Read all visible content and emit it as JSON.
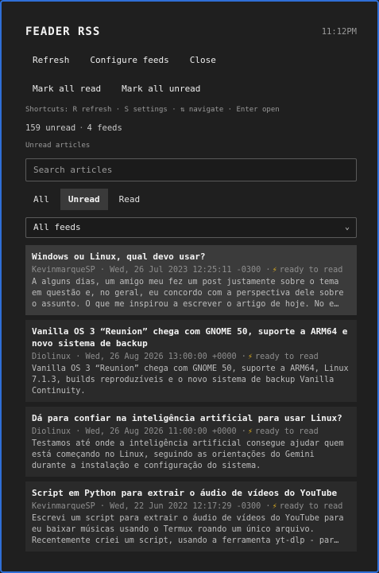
{
  "app": {
    "title": "FEADER RSS",
    "clock": "11:12PM"
  },
  "toolbar": {
    "refresh": "Refresh",
    "configure": "Configure feeds",
    "close": "Close",
    "mark_all_read": "Mark all read",
    "mark_all_unread": "Mark all unread"
  },
  "shortcuts": "Shortcuts: R refresh · S settings · ⇅ navigate · Enter open",
  "counts": {
    "unread": "159 unread",
    "sep": "·",
    "feeds": "4 feeds"
  },
  "section_label": "Unread articles",
  "search": {
    "placeholder": "Search articles",
    "value": ""
  },
  "tabs": [
    {
      "label": "All",
      "active": false
    },
    {
      "label": "Unread",
      "active": true
    },
    {
      "label": "Read",
      "active": false
    }
  ],
  "feed_filter": {
    "selected": "All feeds"
  },
  "articles": [
    {
      "title": "Windows ou Linux, qual devo usar?",
      "author": "KevinmarqueSP",
      "date": "Wed, 26 Jul 2023 12:25:11 -0300",
      "status": "ready to read",
      "snippet": "A alguns dias, um amigo meu fez um post justamente sobre o tema em questão e, no geral, eu concordo com a perspectiva dele sobre o assunto. O que me inspirou a escrever o artigo de hoje. No e…"
    },
    {
      "title": "Vanilla OS 3 “Reunion” chega com GNOME 50, suporte a ARM64 e novo sistema de backup",
      "author": "Diolinux",
      "date": "Wed, 26 Aug 2026 13:00:00 +0000",
      "status": "ready to read",
      "snippet": "Vanilla OS 3 “Reunion” chega com GNOME 50, suporte a ARM64, Linux 7.1.3, builds reproduzíveis e o novo sistema de backup Vanilla Continuity."
    },
    {
      "title": "Dá para confiar na inteligência artificial para usar Linux?",
      "author": "Diolinux",
      "date": "Wed, 26 Aug 2026 11:00:00 +0000",
      "status": "ready to read",
      "snippet": "Testamos até onde a inteligência artificial consegue ajudar quem está começando no Linux, seguindo as orientações do Gemini durante a instalação e configuração do sistema."
    },
    {
      "title": "Script em Python para extrair o áudio de vídeos do YouTube",
      "author": "KevinmarqueSP",
      "date": "Wed, 22 Jun 2022 12:17:29 -0300",
      "status": "ready to read",
      "snippet": "Escrevi um script para extrair o áudio de vídeos do YouTube para eu baixar músicas usando o Termux roando um único arquivo. Recentemente criei um script, usando a ferramenta yt-dlp - par…"
    }
  ],
  "colors": {
    "accent_border": "#2f6fd6",
    "bolt": "#e0b020",
    "background": "#1f1f1f"
  }
}
